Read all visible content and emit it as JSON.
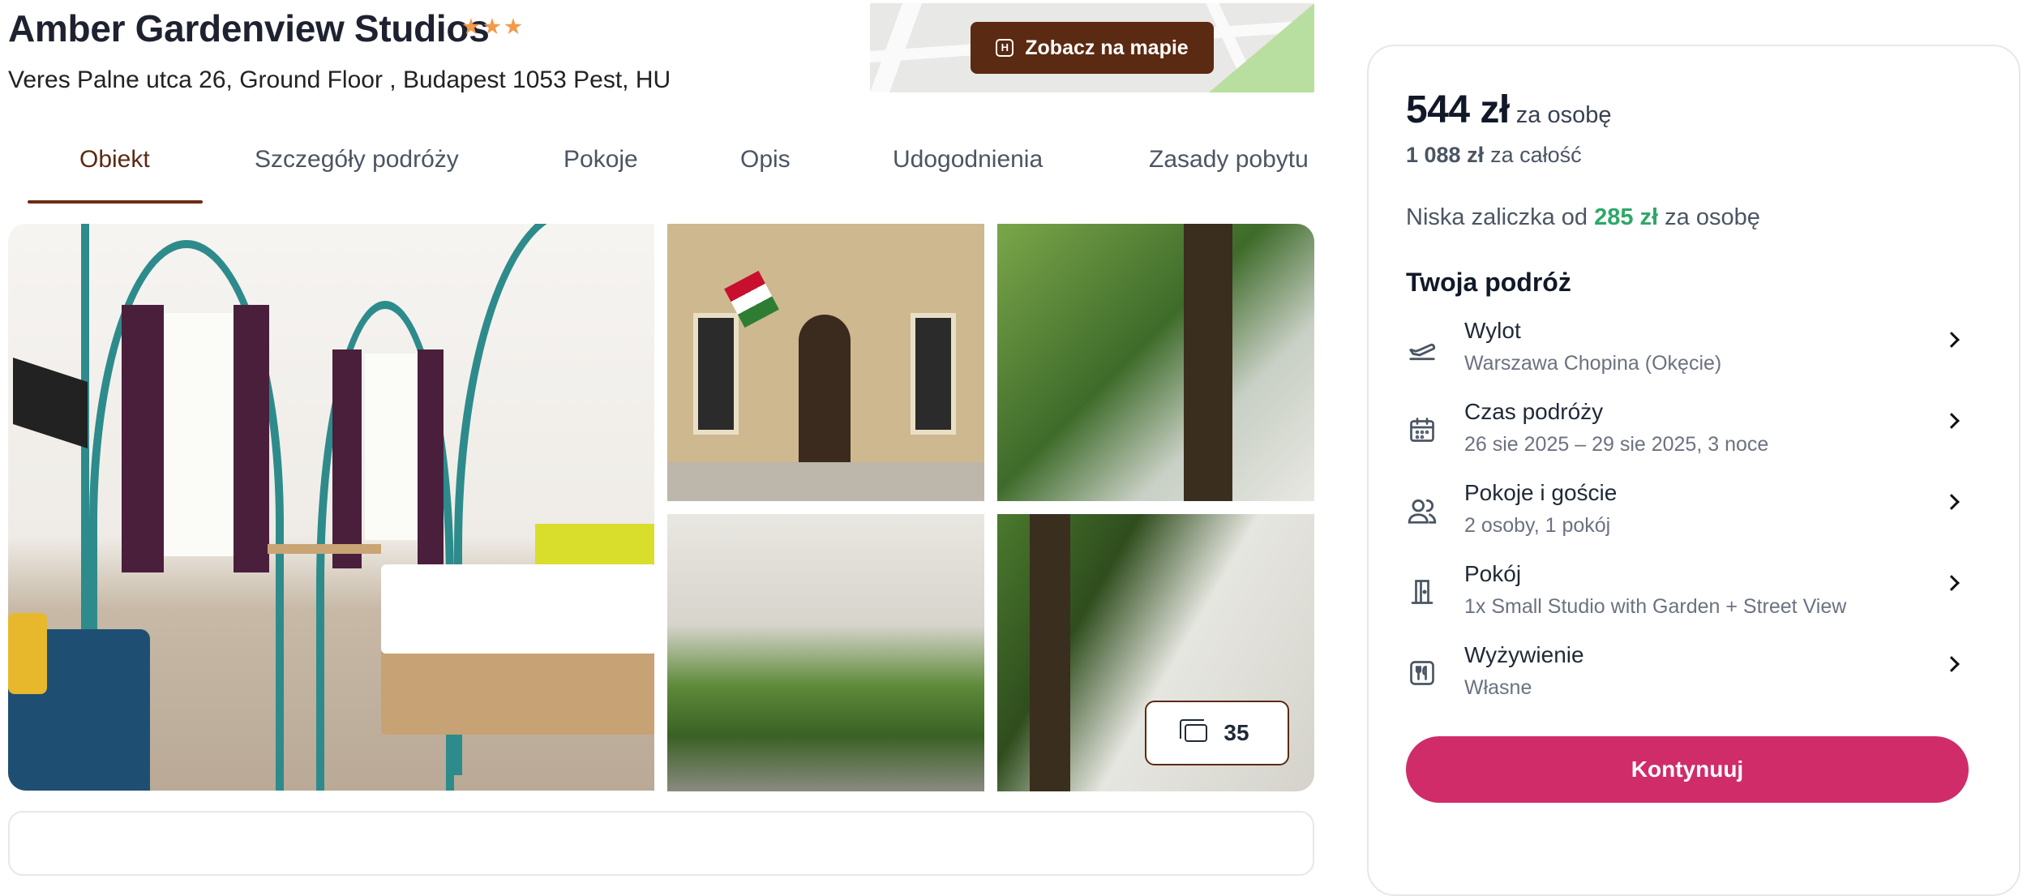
{
  "hotel": {
    "name": "Amber Gardenview Studios",
    "stars": 3,
    "address": "Veres Palne utca 26, Ground Floor , Budapest 1053 Pest, HU",
    "map_button_label": "Zobacz na mapie"
  },
  "tabs": [
    {
      "label": "Obiekt",
      "active": true
    },
    {
      "label": "Szczegóły podróży",
      "active": false
    },
    {
      "label": "Pokoje",
      "active": false
    },
    {
      "label": "Opis",
      "active": false
    },
    {
      "label": "Udogodnienia",
      "active": false
    },
    {
      "label": "Zasady pobytu",
      "active": false
    }
  ],
  "gallery": {
    "photo_count": "35"
  },
  "booking": {
    "price_per_person": "544 zł",
    "price_per_person_suffix": "za osobę",
    "price_total": "1 088 zł",
    "price_total_suffix": "za całość",
    "deposit_prefix": "Niska zaliczka od",
    "deposit_amount": "285 zł",
    "deposit_suffix": "za osobę",
    "trip_title": "Twoja podróż",
    "rows": [
      {
        "icon": "plane-departure-icon",
        "label": "Wylot",
        "value": "Warszawa Chopina (Okęcie)"
      },
      {
        "icon": "calendar-icon",
        "label": "Czas podróży",
        "value": "26 sie 2025 – 29 sie 2025, 3 noce"
      },
      {
        "icon": "users-icon",
        "label": "Pokoje i goście",
        "value": "2 osoby, 1 pokój"
      },
      {
        "icon": "door-icon",
        "label": "Pokój",
        "value": "1x Small Studio with Garden + Street View"
      },
      {
        "icon": "cutlery-icon",
        "label": "Wyżywienie",
        "value": "Własne"
      }
    ],
    "continue_label": "Kontynuuj"
  },
  "colors": {
    "brand_brown": "#5b2a12",
    "accent_pink": "#d02c6a",
    "deposit_green": "#2ea86a",
    "star_orange": "#f2994a"
  }
}
